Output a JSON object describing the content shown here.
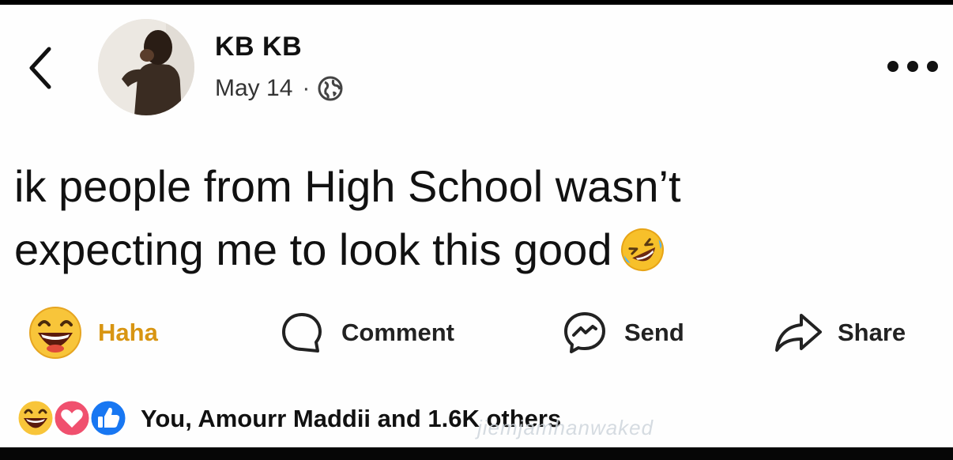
{
  "post": {
    "author": "KB KB",
    "date": "May 14",
    "separator": "·",
    "text_line1": "ik people from High School wasn’t",
    "text_line2": "expecting me to look this good",
    "audience_icon": "globe-icon",
    "emoji_icon": "rolling-on-floor-laughing-icon"
  },
  "actions": {
    "reaction_label": "Haha",
    "comment_label": "Comment",
    "send_label": "Send",
    "share_label": "Share"
  },
  "reactions": {
    "icons": [
      "haha-icon",
      "love-icon",
      "like-icon"
    ],
    "summary": "You, Amourr Maddii and 1.6K others",
    "watermark": "jiemjamhanwaked"
  },
  "colors": {
    "haha": "#d89512",
    "love": "#f0506e",
    "like": "#1877f2",
    "text": "#111111",
    "background": "#fefefe"
  }
}
